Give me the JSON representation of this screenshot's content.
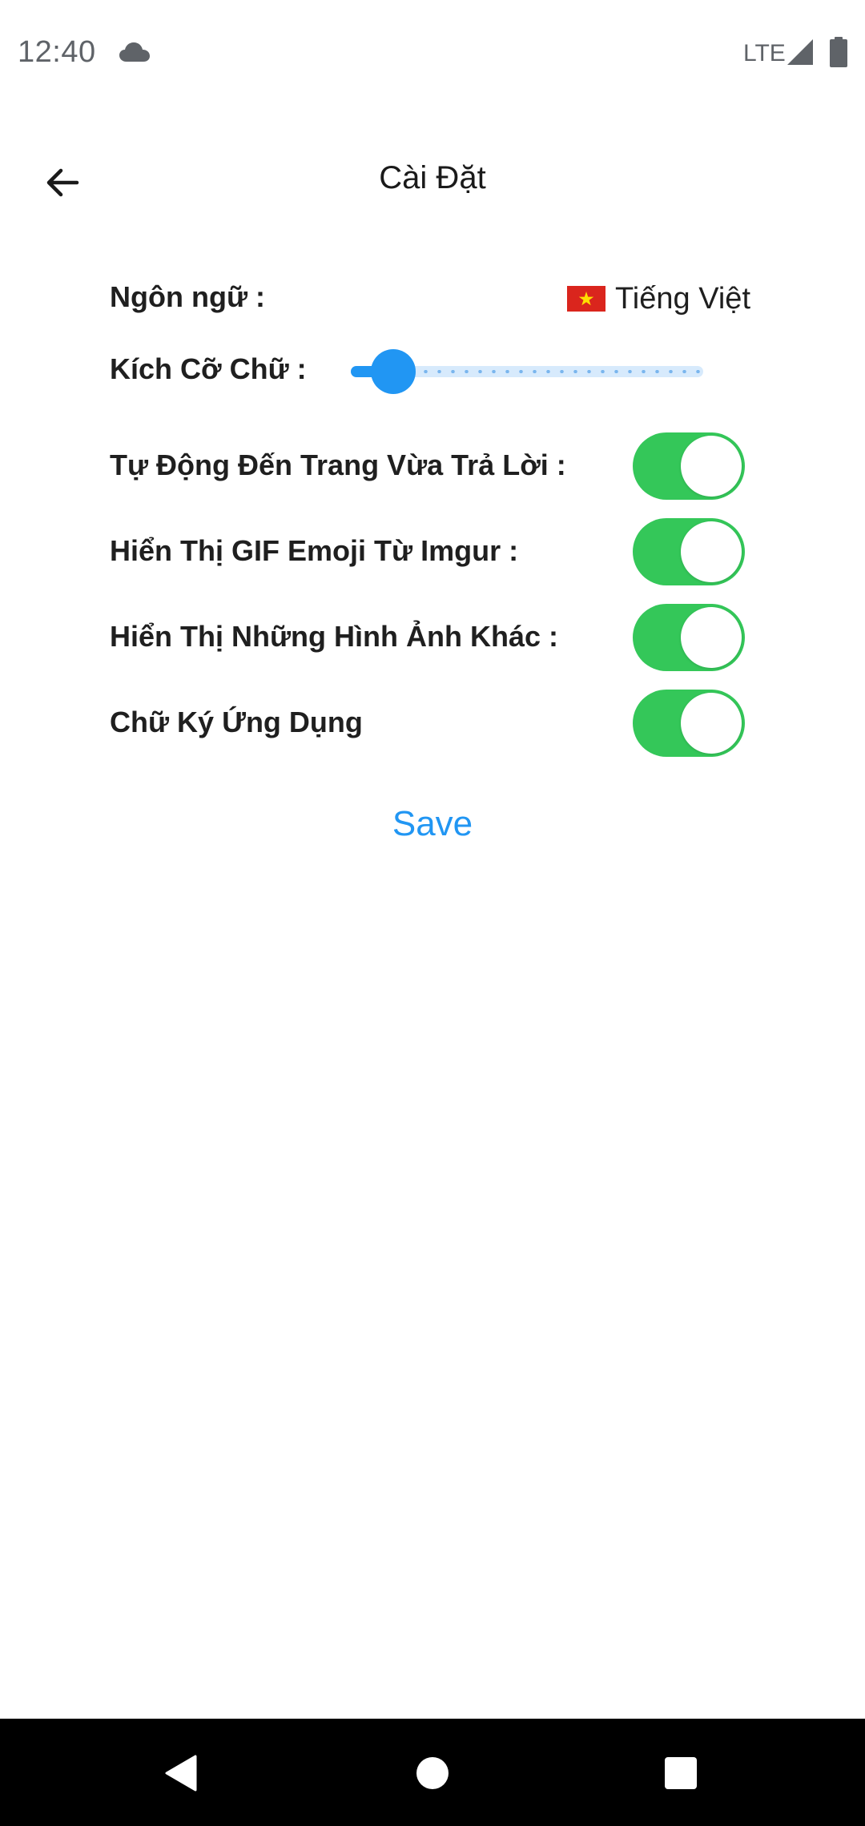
{
  "status_bar": {
    "time": "12:40",
    "network": "LTE",
    "icons": [
      "cloud-icon",
      "signal-icon",
      "battery-icon"
    ]
  },
  "header": {
    "title": "Cài Đặt",
    "back_icon": "arrow-left-icon"
  },
  "settings": {
    "language": {
      "label": "Ngôn ngữ :",
      "value": "Tiếng Việt",
      "flag_icon": "vietnam-flag-icon"
    },
    "font_size": {
      "label": "Kích Cỡ Chữ :",
      "level": 0.12
    },
    "toggles": [
      {
        "label": "Tự Động Đến Trang Vừa Trả Lời :",
        "on": true
      },
      {
        "label": "Hiển Thị GIF Emoji Từ Imgur :",
        "on": true
      },
      {
        "label": "Hiển Thị Những Hình Ảnh Khác :",
        "on": true
      },
      {
        "label": "Chữ Ký Ứng Dụng",
        "on": true
      }
    ],
    "save_label": "Save"
  },
  "nav_bar": {
    "icons": [
      "back-triangle-icon",
      "home-circle-icon",
      "recents-square-icon"
    ]
  },
  "colors": {
    "accent": "#2196f3",
    "toggle_on": "#34c759",
    "nav_bar": "#000000"
  }
}
